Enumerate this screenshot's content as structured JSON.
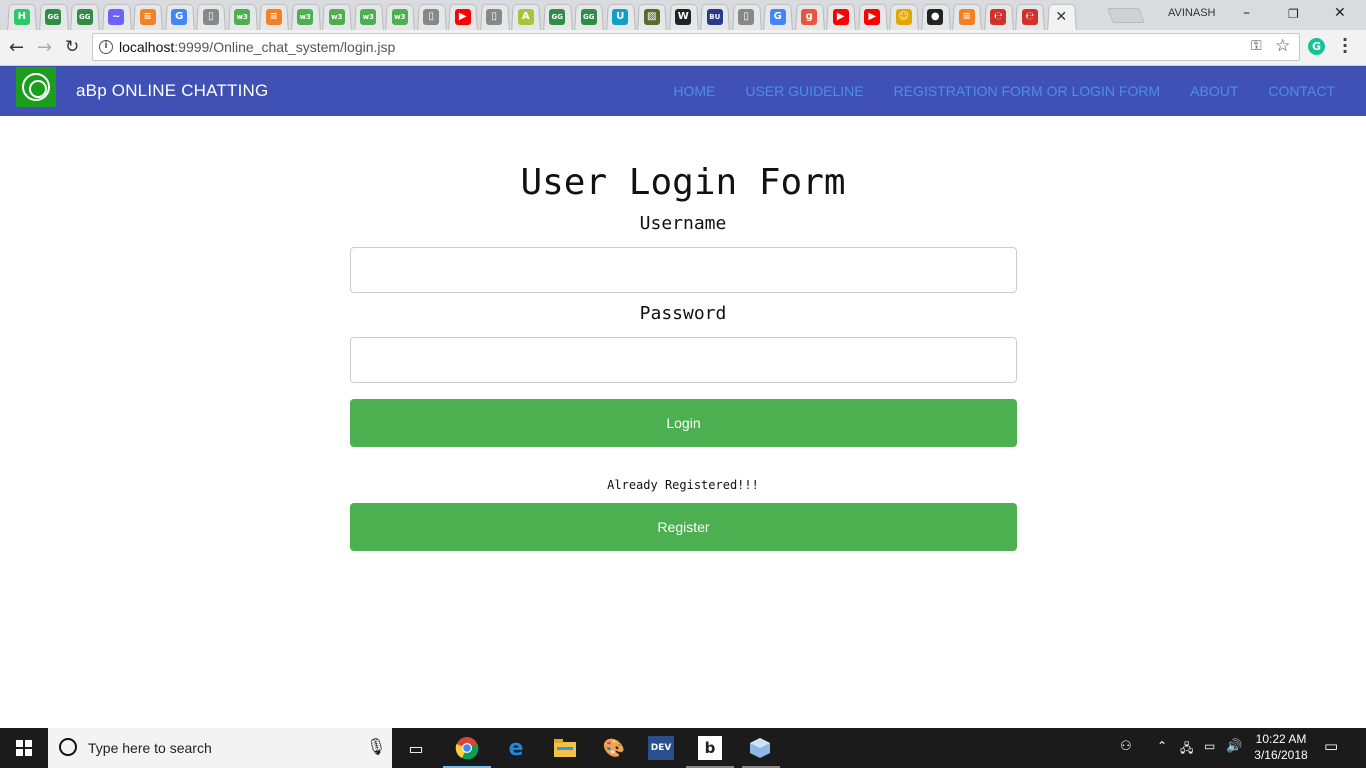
{
  "browser": {
    "tab_favicons": [
      {
        "icon": "hackerrank-icon",
        "glyph": "H",
        "color": "#2ec866"
      },
      {
        "icon": "geeksforgeeks-icon",
        "glyph": "GG",
        "color": "#2f8d46"
      },
      {
        "icon": "geeksforgeeks-icon",
        "glyph": "GG",
        "color": "#2f8d46"
      },
      {
        "icon": "wave-icon",
        "glyph": "~",
        "color": "#6c63ff"
      },
      {
        "icon": "stackoverflow-icon",
        "glyph": "≡",
        "color": "#f48024"
      },
      {
        "icon": "google-icon",
        "glyph": "G",
        "color": "#4285f4"
      },
      {
        "icon": "page-icon",
        "glyph": "▯",
        "color": "#888888"
      },
      {
        "icon": "w3schools-icon",
        "glyph": "w3",
        "color": "#4caf50"
      },
      {
        "icon": "stackoverflow-icon",
        "glyph": "≡",
        "color": "#f48024"
      },
      {
        "icon": "w3schools-icon",
        "glyph": "w3",
        "color": "#4caf50"
      },
      {
        "icon": "w3schools-icon",
        "glyph": "w3",
        "color": "#4caf50"
      },
      {
        "icon": "w3schools-icon",
        "glyph": "w3",
        "color": "#4caf50"
      },
      {
        "icon": "w3schools-icon",
        "glyph": "w3",
        "color": "#4caf50"
      },
      {
        "icon": "page-icon",
        "glyph": "▯",
        "color": "#888888"
      },
      {
        "icon": "youtube-icon",
        "glyph": "▶",
        "color": "#ff0000"
      },
      {
        "icon": "page-icon",
        "glyph": "▯",
        "color": "#888888"
      },
      {
        "icon": "android-icon",
        "glyph": "A",
        "color": "#a4c639"
      },
      {
        "icon": "geeksforgeeks-icon",
        "glyph": "GG",
        "color": "#2f8d46"
      },
      {
        "icon": "geeksforgeeks-icon",
        "glyph": "GG",
        "color": "#2f8d46"
      },
      {
        "icon": "udemy-icon",
        "glyph": "U",
        "color": "#0f9fc9"
      },
      {
        "icon": "image-icon",
        "glyph": "▨",
        "color": "#556b2f"
      },
      {
        "icon": "wikipedia-icon",
        "glyph": "W",
        "color": "#222222"
      },
      {
        "icon": "bu-icon",
        "glyph": "BU",
        "color": "#2b3a8c"
      },
      {
        "icon": "page-icon",
        "glyph": "▯",
        "color": "#888888"
      },
      {
        "icon": "google-icon",
        "glyph": "G",
        "color": "#4285f4"
      },
      {
        "icon": "g-icon",
        "glyph": "g",
        "color": "#e8543f"
      },
      {
        "icon": "youtube-icon",
        "glyph": "▶",
        "color": "#ff0000"
      },
      {
        "icon": "youtube-icon",
        "glyph": "▶",
        "color": "#ff0000"
      },
      {
        "icon": "figure-icon",
        "glyph": "☺",
        "color": "#e0a800"
      },
      {
        "icon": "github-icon",
        "glyph": "●",
        "color": "#222222"
      },
      {
        "icon": "stackoverflow-icon",
        "glyph": "≡",
        "color": "#f48024"
      },
      {
        "icon": "swirl-icon",
        "glyph": "℮",
        "color": "#d0312d"
      },
      {
        "icon": "swirl-icon",
        "glyph": "℮",
        "color": "#d0312d"
      }
    ],
    "profile_name": "AVINASH",
    "url_host": "localhost",
    "url_rest": ":9999/Online_chat_system/login.jsp"
  },
  "site": {
    "brand": "aBp ONLINE CHATTING",
    "nav": [
      "HOME",
      "USER GUIDELINE",
      "REGISTRATION FORM OR LOGIN FORM",
      "ABOUT",
      "CONTACT"
    ],
    "nav_link_color": "#4c8fe0",
    "navbar_color": "#3f51b5",
    "button_color": "#4caf50"
  },
  "form": {
    "title": "User Login Form",
    "username_label": "Username",
    "username_value": "",
    "password_label": "Password",
    "password_value": "",
    "login_label": "Login",
    "already_registered": "Already Registered!!!",
    "register_label": "Register"
  },
  "taskbar": {
    "search_placeholder": "Type here to search",
    "time": "10:22 AM",
    "date": "3/16/2018"
  }
}
